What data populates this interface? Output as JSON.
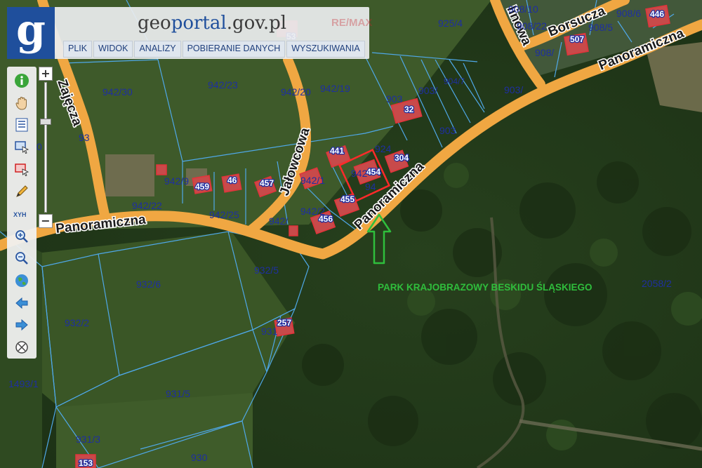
{
  "header": {
    "logo_letter": "g",
    "site_prefix": "geo",
    "site_accent": "portal",
    "site_suffix": ".gov.pl",
    "watermark": "RE/MAX",
    "menu": [
      "PLIK",
      "WIDOK",
      "ANALIZY",
      "POBIERANIE DANYCH",
      "WYSZUKIWANIA"
    ]
  },
  "toolbar": {
    "tools": [
      "info-icon",
      "hand-pan-icon",
      "list-icon",
      "select-rectangle-icon",
      "select-rectangle-red-icon",
      "pencil-icon",
      "xyh-coordinates-icon",
      "zoom-in-icon",
      "zoom-out-icon",
      "globe-icon",
      "arrow-left-icon",
      "arrow-right-icon",
      "crosshair-icon"
    ],
    "xyh_label": "XYH"
  },
  "zoom": {
    "plus": "+",
    "minus": "−",
    "level_fraction": 0.3
  },
  "streets": {
    "panoramiczna": "Panoramiczna",
    "zajecza": "Zajęcza",
    "jalowcowa": "Jałowcowa",
    "borsucza": "Borsucza",
    "lnowa": "linowa"
  },
  "parcels": [
    "942/30",
    "942/23",
    "942/20",
    "942/19",
    "903",
    "903/",
    "904/7",
    "925/4",
    "908/10",
    "908/22",
    "908/5",
    "908/6",
    "908/",
    "932/6",
    "932/2",
    "932/5",
    "931",
    "931/5",
    "931/3",
    "930",
    "1493/1",
    "2058/2",
    "942/22",
    "942/9",
    "942/25",
    "942/",
    "942/2",
    "942/1",
    "942",
    "94",
    "903/",
    "903",
    "924",
    "93",
    "0"
  ],
  "buildings": [
    "459",
    "46",
    "457",
    "441",
    "454",
    "304",
    "455",
    "456",
    "32",
    "507",
    "446",
    "257",
    "153",
    "53"
  ],
  "park_label": "PARK KRAJOBRAZOWY BESKIDU ŚLĄSKIEGO",
  "colors": {
    "road": "#f0a742",
    "parcel_line": "#4fa8e8",
    "parcel_label": "#1e2fa0",
    "building": "#e2333a",
    "marker": "#2fbe3c",
    "logo_bg": "#1f4f9c"
  }
}
